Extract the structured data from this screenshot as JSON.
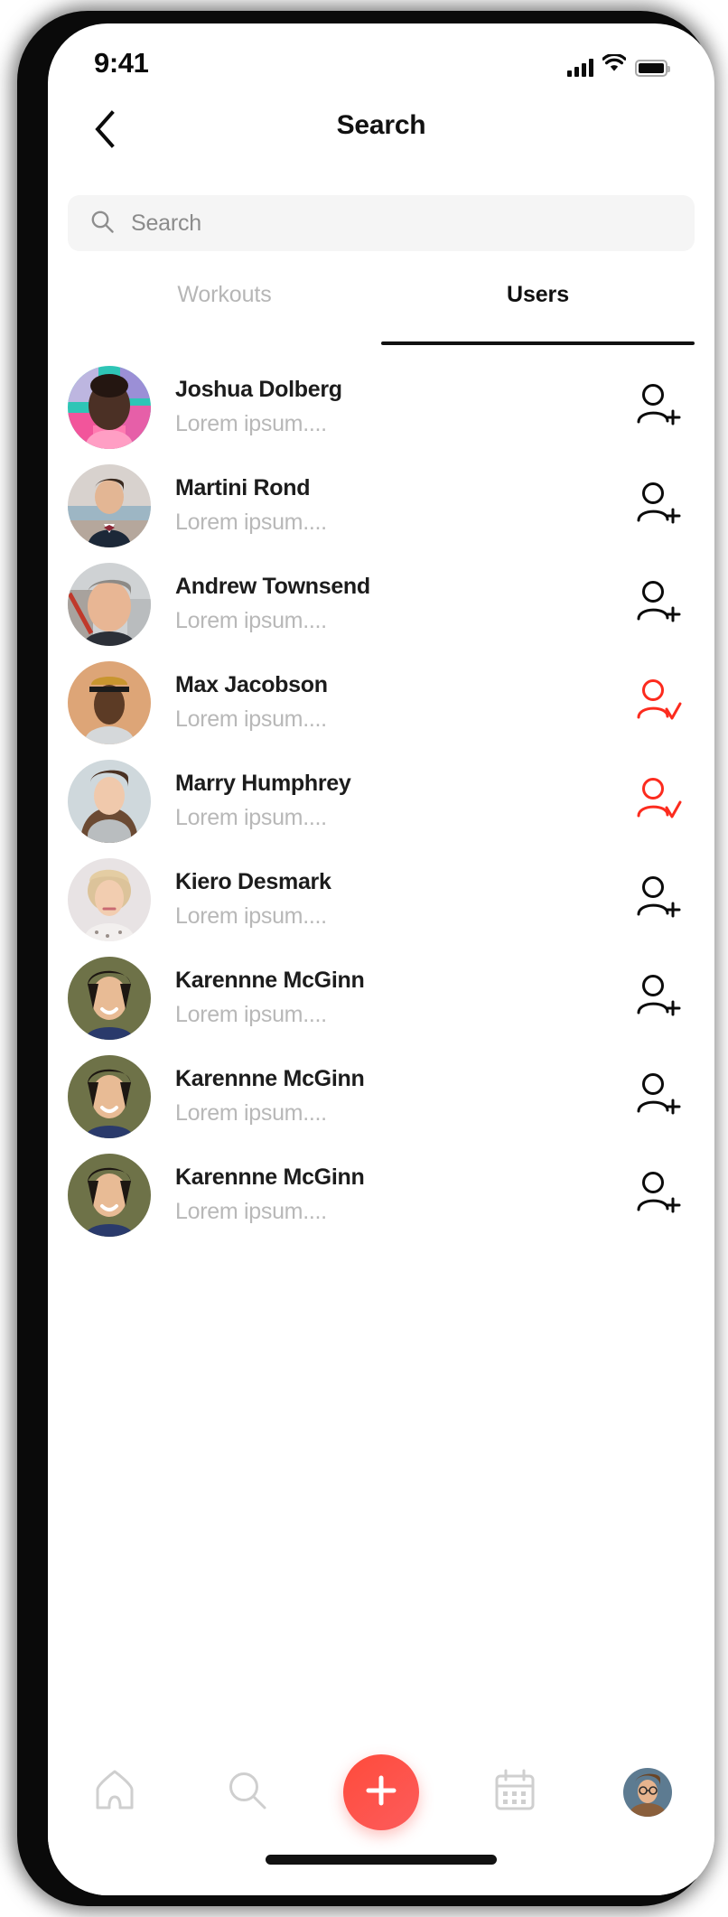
{
  "status_bar": {
    "time": "9:41",
    "signal_icon": "signal-bars-icon",
    "wifi_icon": "wifi-icon",
    "battery_icon": "battery-full-icon"
  },
  "header": {
    "title": "Search",
    "back_icon": "chevron-left-icon"
  },
  "search": {
    "placeholder": "Search",
    "value": "",
    "icon": "search-icon"
  },
  "tabs": [
    {
      "label": "Workouts",
      "active": false
    },
    {
      "label": "Users",
      "active": true
    }
  ],
  "colors": {
    "accent_red": "#FC5145",
    "fab_gradient_start": "#FF4B3B",
    "fab_gradient_end": "#FC5C5C",
    "text_primary": "#1C1C1C",
    "text_muted": "#B8B8B8",
    "tab_inactive": "#B6B6B6",
    "search_bg": "#F5F5F5"
  },
  "users": [
    {
      "name": "Joshua Dolberg",
      "subtitle": "Lorem ipsum....",
      "action": "add-user",
      "following": false,
      "avatar": "man-graffiti-background"
    },
    {
      "name": "Martini Rond",
      "subtitle": "Lorem ipsum....",
      "action": "add-user",
      "following": false,
      "avatar": "man-bowtie-suit"
    },
    {
      "name": "Andrew Townsend",
      "subtitle": "Lorem ipsum....",
      "action": "add-user",
      "following": false,
      "avatar": "man-short-hair"
    },
    {
      "name": "Max Jacobson",
      "subtitle": "Lorem ipsum....",
      "action": "following",
      "following": true,
      "avatar": "man-with-cap"
    },
    {
      "name": "Marry Humphrey",
      "subtitle": "Lorem ipsum....",
      "action": "following",
      "following": true,
      "avatar": "woman-turtleneck"
    },
    {
      "name": "Kiero Desmark",
      "subtitle": "Lorem ipsum....",
      "action": "add-user",
      "following": false,
      "avatar": "woman-blonde-bob"
    },
    {
      "name": "Karennne McGinn",
      "subtitle": "Lorem ipsum....",
      "action": "add-user",
      "following": false,
      "avatar": "person-dark-hair-olive"
    },
    {
      "name": "Karennne McGinn",
      "subtitle": "Lorem ipsum....",
      "action": "add-user",
      "following": false,
      "avatar": "person-dark-hair-olive"
    },
    {
      "name": "Karennne McGinn",
      "subtitle": "Lorem ipsum....",
      "action": "add-user",
      "following": false,
      "avatar": "person-dark-hair-olive"
    }
  ],
  "tabbar": [
    {
      "name": "home",
      "icon": "home-icon"
    },
    {
      "name": "search",
      "icon": "search-icon"
    },
    {
      "name": "create",
      "icon": "plus-icon"
    },
    {
      "name": "calendar",
      "icon": "calendar-icon"
    },
    {
      "name": "profile",
      "icon": "profile-avatar"
    }
  ]
}
